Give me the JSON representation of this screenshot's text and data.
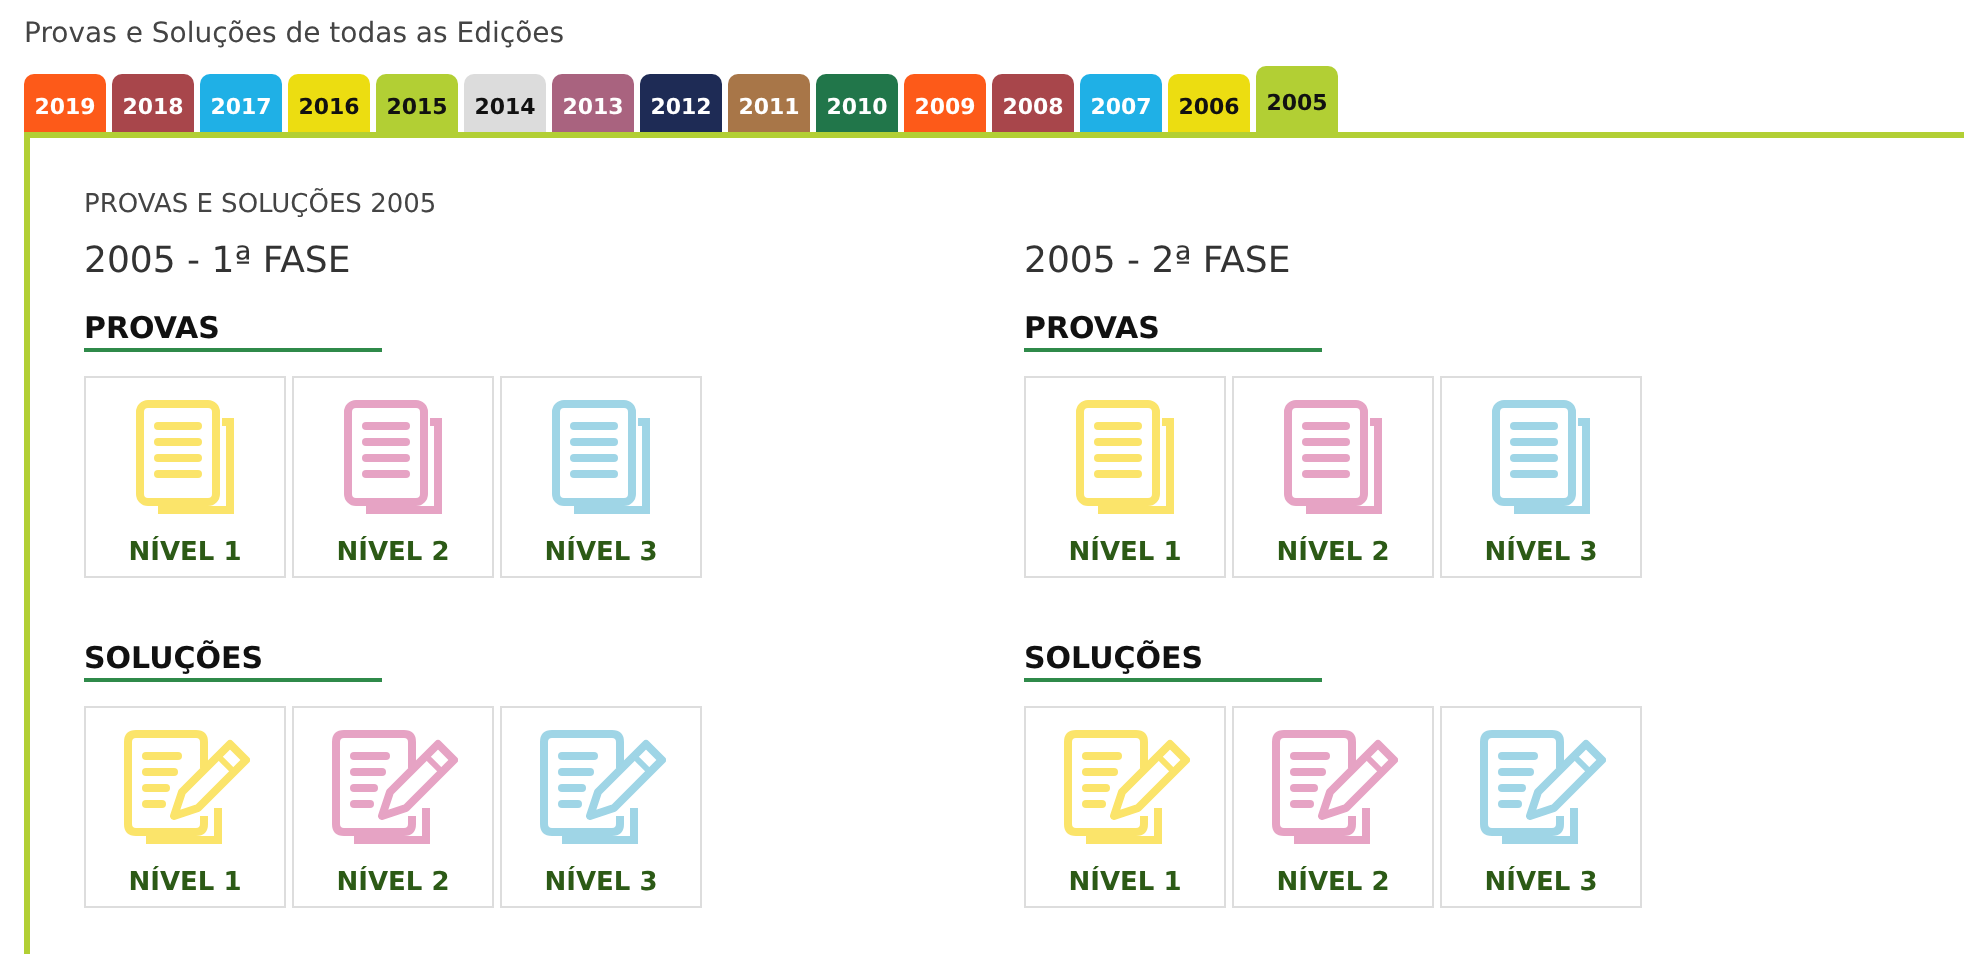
{
  "page_title": "Provas e Soluções de todas as Edições",
  "tabs": [
    {
      "label": "2019",
      "color": "#fd5a19",
      "selected": false
    },
    {
      "label": "2018",
      "color": "#a8464b",
      "selected": false
    },
    {
      "label": "2017",
      "color": "#1fb0e6",
      "selected": false
    },
    {
      "label": "2016",
      "color": "#ecdd11",
      "selected": false
    },
    {
      "label": "2015",
      "color": "#b2cf34",
      "selected": false
    },
    {
      "label": "2014",
      "color": "#dcdcdc",
      "selected": false
    },
    {
      "label": "2013",
      "color": "#a9637f",
      "selected": false
    },
    {
      "label": "2012",
      "color": "#1e2b55",
      "selected": false
    },
    {
      "label": "2011",
      "color": "#a87648",
      "selected": false
    },
    {
      "label": "2010",
      "color": "#21764a",
      "selected": false
    },
    {
      "label": "2009",
      "color": "#fd5a19",
      "selected": false
    },
    {
      "label": "2008",
      "color": "#a8464b",
      "selected": false
    },
    {
      "label": "2007",
      "color": "#1fb0e6",
      "selected": false
    },
    {
      "label": "2006",
      "color": "#ecdd11",
      "selected": false
    },
    {
      "label": "2005",
      "color": "#b2cf34",
      "selected": true
    }
  ],
  "panel": {
    "heading": "PROVAS E SOLUÇÕES 2005",
    "phases": [
      {
        "title": "2005 - 1ª FASE",
        "sections": [
          {
            "heading": "PROVAS",
            "kind": "document",
            "tiles": [
              {
                "label": "NÍVEL 1",
                "color": "#fbe46a"
              },
              {
                "label": "NÍVEL 2",
                "color": "#e6a3c4"
              },
              {
                "label": "NÍVEL 3",
                "color": "#9fd5e6"
              }
            ]
          },
          {
            "heading": "SOLUÇÕES",
            "kind": "edit",
            "tiles": [
              {
                "label": "NÍVEL 1",
                "color": "#fbe46a"
              },
              {
                "label": "NÍVEL 2",
                "color": "#e6a3c4"
              },
              {
                "label": "NÍVEL 3",
                "color": "#9fd5e6"
              }
            ]
          }
        ]
      },
      {
        "title": "2005 - 2ª FASE",
        "sections": [
          {
            "heading": "PROVAS",
            "kind": "document",
            "tiles": [
              {
                "label": "NÍVEL 1",
                "color": "#fbe46a"
              },
              {
                "label": "NÍVEL 2",
                "color": "#e6a3c4"
              },
              {
                "label": "NÍVEL 3",
                "color": "#9fd5e6"
              }
            ]
          },
          {
            "heading": "SOLUÇÕES",
            "kind": "edit",
            "tiles": [
              {
                "label": "NÍVEL 1",
                "color": "#fbe46a"
              },
              {
                "label": "NÍVEL 2",
                "color": "#e6a3c4"
              },
              {
                "label": "NÍVEL 3",
                "color": "#9fd5e6"
              }
            ]
          }
        ]
      }
    ]
  }
}
